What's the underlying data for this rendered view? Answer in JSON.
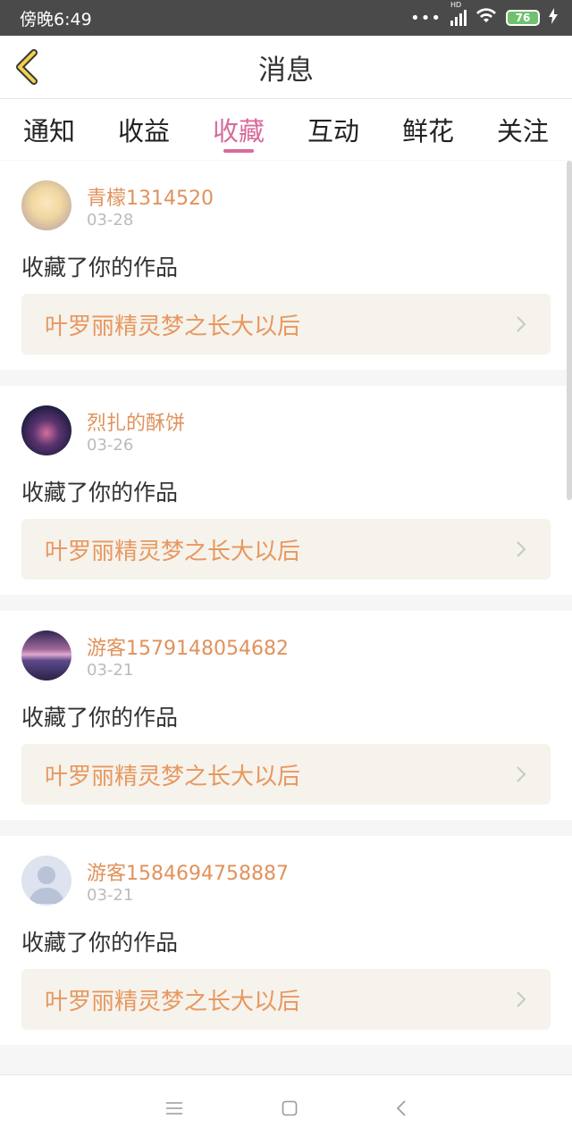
{
  "status_bar": {
    "time": "傍晚6:49",
    "signal_label": "HD",
    "battery": "76"
  },
  "header": {
    "title": "消息"
  },
  "tabs": [
    {
      "label": "通知"
    },
    {
      "label": "收益"
    },
    {
      "label": "收藏",
      "active": true
    },
    {
      "label": "互动"
    },
    {
      "label": "鲜花"
    },
    {
      "label": "关注"
    }
  ],
  "messages": [
    {
      "user": "青檬1314520",
      "date": "03-28",
      "action": "收藏了你的作品",
      "work": "叶罗丽精灵梦之长大以后"
    },
    {
      "user": "烈扎的酥饼",
      "date": "03-26",
      "action": "收藏了你的作品",
      "work": "叶罗丽精灵梦之长大以后"
    },
    {
      "user": "游客1579148054682",
      "date": "03-21",
      "action": "收藏了你的作品",
      "work": "叶罗丽精灵梦之长大以后"
    },
    {
      "user": "游客1584694758887",
      "date": "03-21",
      "action": "收藏了你的作品",
      "work": "叶罗丽精灵梦之长大以后"
    }
  ],
  "colors": {
    "accent": "#d86b9c",
    "username": "#e0925c",
    "work_title": "#e8975f"
  }
}
